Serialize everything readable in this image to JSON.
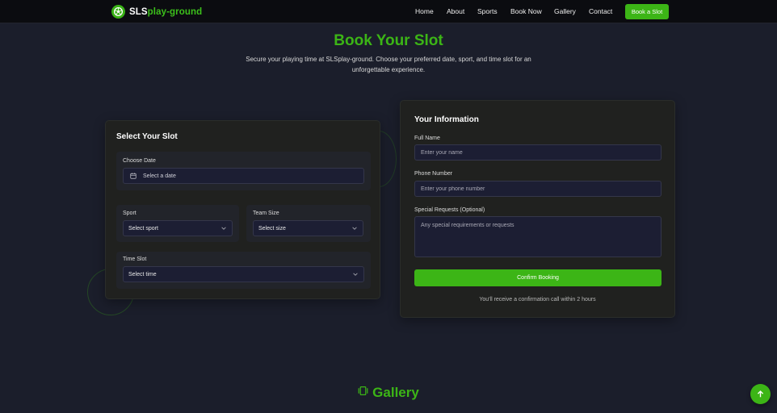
{
  "brand": {
    "prefix": "SLS",
    "suffix": "play-ground"
  },
  "nav": {
    "links": [
      "Home",
      "About",
      "Sports",
      "Book Now",
      "Gallery",
      "Contact"
    ],
    "cta": "Book a Slot"
  },
  "hero": {
    "title": "Book Your Slot",
    "subtitle": "Secure your playing time at SLSplay-ground. Choose your preferred date, sport, and time slot for an unforgettable experience."
  },
  "slot": {
    "title": "Select Your Slot",
    "date_label": "Choose Date",
    "date_placeholder": "Select a date",
    "sport_label": "Sport",
    "sport_value": "Select sport",
    "team_label": "Team Size",
    "team_value": "Select size",
    "time_label": "Time Slot",
    "time_value": "Select time"
  },
  "info": {
    "title": "Your Information",
    "name_label": "Full Name",
    "name_placeholder": "Enter your name",
    "phone_label": "Phone Number",
    "phone_placeholder": "Enter your phone number",
    "requests_label": "Special Requests (Optional)",
    "requests_placeholder": "Any special requirements or requests",
    "confirm": "Confirm Booking",
    "note": "You'll receive a confirmation call within 2 hours"
  },
  "gallery": {
    "title": "Gallery"
  },
  "colors": {
    "accent": "#3cb516",
    "background": "#1b1e2b",
    "card": "#20211f",
    "input": "#1c1e33"
  },
  "icons": {
    "brand": "soccer-ball-icon",
    "date": "calendar-icon",
    "gallery": "gallery-icon",
    "scroll": "arrow-up-icon",
    "dropdown": "chevron-down-icon"
  }
}
